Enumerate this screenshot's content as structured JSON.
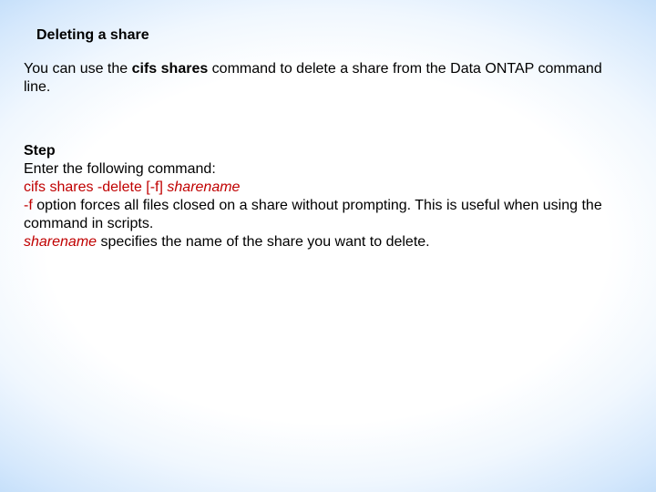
{
  "heading": "Deleting a share",
  "intro": {
    "pre": "You can use the ",
    "cmd": "cifs shares",
    "post": " command to delete a share from the Data ONTAP command line."
  },
  "step": {
    "label": "Step",
    "line1": "Enter the following command:",
    "syntax": {
      "cmd": "cifs shares -delete [-f] ",
      "arg": "sharename"
    },
    "opt": {
      "flag": "-f",
      "desc": " option forces all files closed on a share without prompting. This is useful when using the command in scripts."
    },
    "arg": {
      "name": "sharename",
      "desc": " specifies the name of the share you want to delete."
    }
  }
}
